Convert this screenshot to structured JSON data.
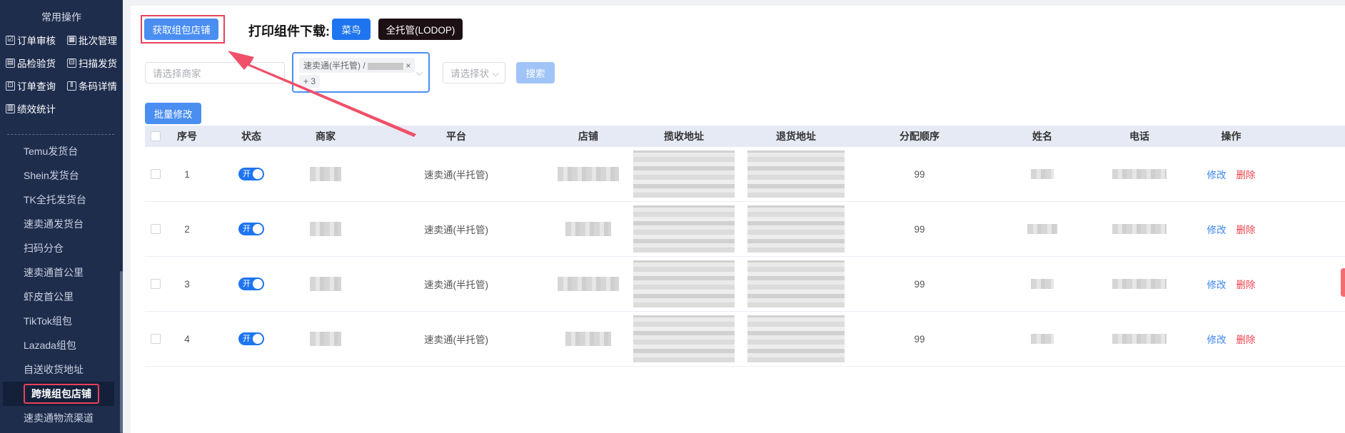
{
  "sidebar": {
    "section_title": "常用操作",
    "quick_actions": [
      {
        "label": "订单审核",
        "icon": "check-square-icon",
        "glyph": "☑"
      },
      {
        "label": "批次管理",
        "icon": "calendar-icon",
        "glyph": "▦"
      },
      {
        "label": "品检验货",
        "icon": "clipboard-icon",
        "glyph": "▤"
      },
      {
        "label": "扫描发货",
        "icon": "scan-icon",
        "glyph": "⊟"
      },
      {
        "label": "订单查询",
        "icon": "search-doc-icon",
        "glyph": "⊡"
      },
      {
        "label": "条码详情",
        "icon": "barcode-icon",
        "glyph": "‖"
      },
      {
        "label": "绩效统计",
        "icon": "chart-icon",
        "glyph": "▥"
      }
    ],
    "nav_items": [
      "Temu发货台",
      "Shein发货台",
      "TK全托发货台",
      "速卖通发货台",
      "扫码分仓",
      "速卖通首公里",
      "虾皮首公里",
      "TikTok组包",
      "Lazada组包",
      "自送收货地址",
      "跨境组包店铺",
      "速卖通物流渠道"
    ],
    "active_item": "跨境组包店铺"
  },
  "toolbar": {
    "fetch_button": "获取组包店铺",
    "print_label": "打印组件下载:",
    "cainiao_button": "菜鸟",
    "lodop_button": "全托管(LODOP)"
  },
  "filters": {
    "merchant_placeholder": "请选择商家",
    "platform_tag": "速卖通(半托管) / ",
    "platform_more": "+ 3",
    "status_placeholder": "请选择状",
    "search_button": "搜索"
  },
  "batch_edit_button": "批量修改",
  "table": {
    "headers": [
      "序号",
      "状态",
      "商家",
      "平台",
      "店铺",
      "揽收地址",
      "退货地址",
      "分配顺序",
      "姓名",
      "电话",
      "操作"
    ],
    "rows": [
      {
        "index": "1",
        "status": "开",
        "platform": "速卖通(半托管)",
        "order": "99"
      },
      {
        "index": "2",
        "status": "开",
        "platform": "速卖通(半托管)",
        "order": "99"
      },
      {
        "index": "3",
        "status": "开",
        "platform": "速卖通(半托管)",
        "order": "99"
      },
      {
        "index": "4",
        "status": "开",
        "platform": "速卖通(半托管)",
        "order": "99"
      }
    ],
    "edit_label": "修改",
    "delete_label": "删除"
  },
  "colors": {
    "sidebar_bg": "#1f2d4d",
    "primary": "#4a8ef2",
    "highlight_red": "#e7425a",
    "delete_red": "#f0444d"
  }
}
